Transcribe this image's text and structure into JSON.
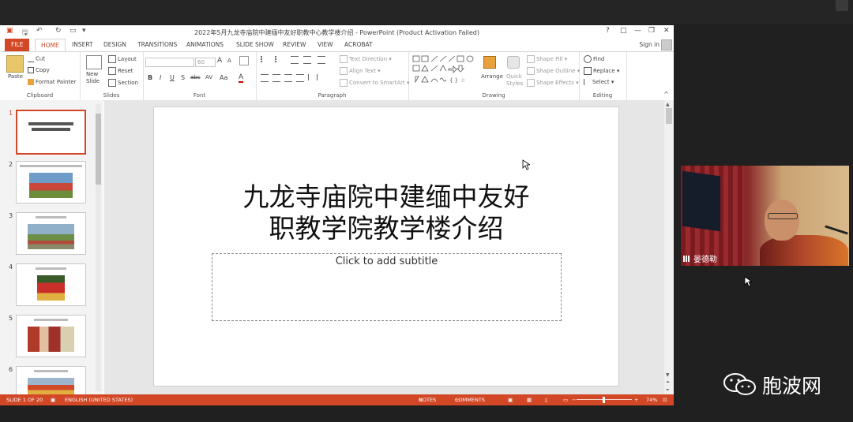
{
  "window": {
    "title": "2022年5月九龙寺庙院中建缅中友好职教中心教学楼介绍 - PowerPoint (Product Activation Failed)",
    "controls": [
      "?",
      "□",
      "—",
      "❐",
      "✕"
    ]
  },
  "tabs": {
    "file": "FILE",
    "items": [
      "HOME",
      "INSERT",
      "DESIGN",
      "TRANSITIONS",
      "ANIMATIONS",
      "SLIDE SHOW",
      "REVIEW",
      "VIEW",
      "ACROBAT"
    ],
    "active": "HOME",
    "signin": "Sign in"
  },
  "ribbon": {
    "clipboard": {
      "label": "Clipboard",
      "paste": "Paste",
      "cut": "Cut",
      "copy": "Copy",
      "format_painter": "Format Painter"
    },
    "slides": {
      "label": "Slides",
      "new_slide_1": "New",
      "new_slide_2": "Slide",
      "layout": "Layout",
      "reset": "Reset",
      "section": "Section"
    },
    "font": {
      "label": "Font",
      "size": "60",
      "bold": "B",
      "italic": "I",
      "underline": "U",
      "shadow": "S",
      "strike": "abc",
      "spacing": "AV",
      "case": "Aa",
      "grow": "A",
      "shrink": "A"
    },
    "paragraph": {
      "label": "Paragraph",
      "text_direction": "Text Direction",
      "align_text": "Align Text",
      "smartart": "Convert to SmartArt"
    },
    "drawing": {
      "label": "Drawing",
      "arrange": "Arrange",
      "quick_styles_1": "Quick",
      "quick_styles_2": "Styles",
      "shape_fill": "Shape Fill",
      "shape_outline": "Shape Outline",
      "shape_effects": "Shape Effects"
    },
    "editing": {
      "label": "Editing",
      "find": "Find",
      "replace": "Replace",
      "select": "Select"
    }
  },
  "thumbnails": [
    {
      "num": "1",
      "selected": true
    },
    {
      "num": "2",
      "selected": false
    },
    {
      "num": "3",
      "selected": false
    },
    {
      "num": "4",
      "selected": false
    },
    {
      "num": "5",
      "selected": false
    },
    {
      "num": "6",
      "selected": false
    }
  ],
  "slide": {
    "title_line1": "九龙寺庙院中建缅中友好",
    "title_line2": "职教学院教学楼介绍",
    "subtitle_placeholder": "Click to add subtitle"
  },
  "status": {
    "slide_count": "SLIDE 1 OF 20",
    "language": "ENGLISH (UNITED STATES)",
    "notes": "NOTES",
    "comments": "COMMENTS",
    "zoom": "74%"
  },
  "video": {
    "participant_name": "晏德勒"
  },
  "watermark": {
    "text": "胞波网"
  },
  "colors": {
    "accent": "#d24726",
    "screen_bg": "#202020"
  }
}
